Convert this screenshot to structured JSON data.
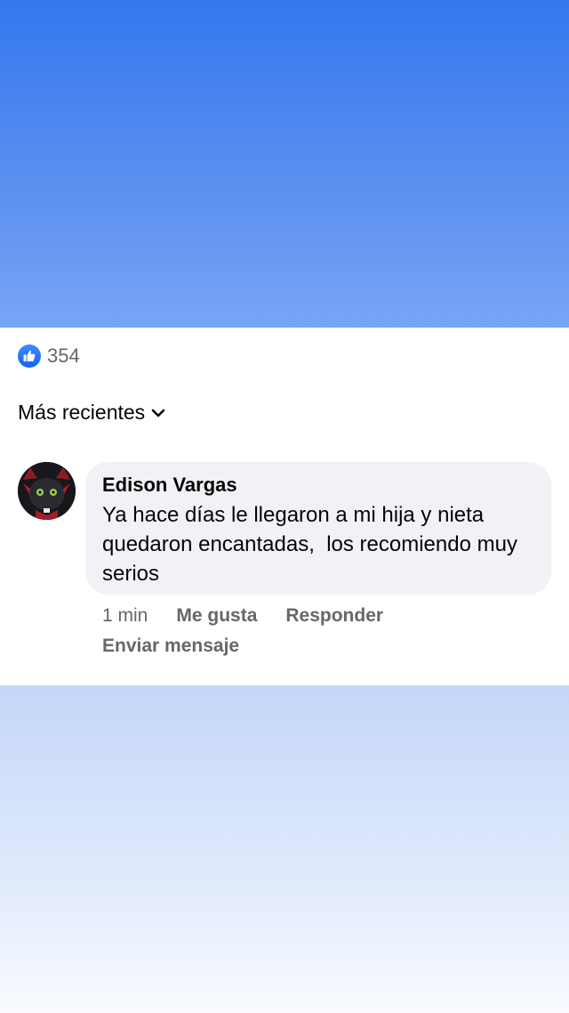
{
  "reactions": {
    "icon": "thumbs-up-icon",
    "count": "354",
    "color": "#1877f2"
  },
  "sort": {
    "label": "Más recientes",
    "icon": "chevron-down-icon"
  },
  "comment": {
    "author": "Edison Vargas",
    "text": "Ya hace días le llegaron a mi hija y nieta quedaron encantadas,  los recomiendo muy serios",
    "time": "1 min",
    "like_label": "Me gusta",
    "reply_label": "Responder",
    "message_label": "Enviar mensaje"
  }
}
